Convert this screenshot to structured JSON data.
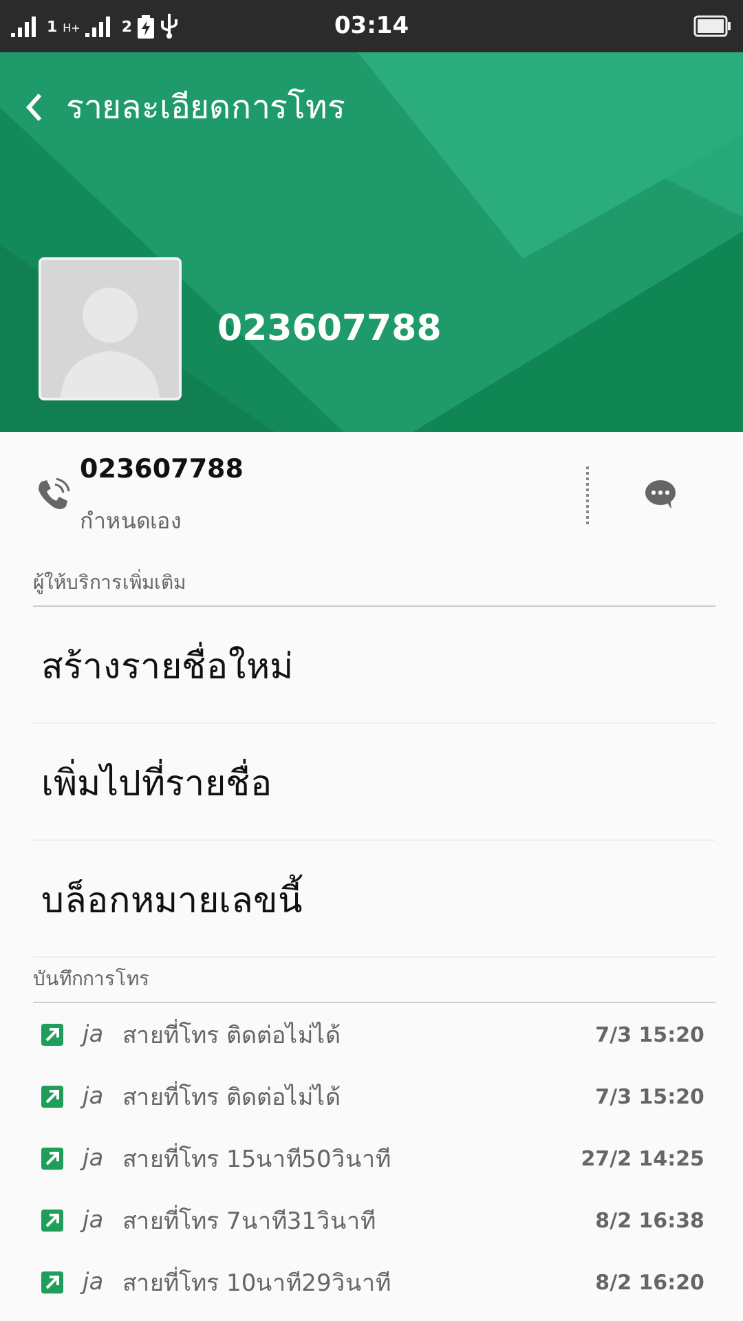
{
  "status_bar": {
    "sim1": "1",
    "network": "H+",
    "sim2": "2",
    "time": "03:14"
  },
  "header": {
    "title": "รายละเอียดการโทร",
    "name": "023607788"
  },
  "contact": {
    "number": "023607788",
    "label": "กำหนดเอง"
  },
  "providers_label": "ผู้ให้บริการเพิ่มเติม",
  "actions": [
    "สร้างรายชื่อใหม่",
    "เพิ่มไปที่รายชื่อ",
    "บล็อกหมายเลขนี้"
  ],
  "log_label": "บันทึกการโทร",
  "calls": [
    {
      "kind": "outgoing",
      "sim": "ja",
      "text": "สายที่โทร ติดต่อไม่ได้",
      "time": "7/3 15:20"
    },
    {
      "kind": "outgoing",
      "sim": "ja",
      "text": "สายที่โทร ติดต่อไม่ได้",
      "time": "7/3 15:20"
    },
    {
      "kind": "outgoing",
      "sim": "ja",
      "text": "สายที่โทร 15นาที50วินาที",
      "time": "27/2 14:25"
    },
    {
      "kind": "outgoing",
      "sim": "ja",
      "text": "สายที่โทร 7นาที31วินาที",
      "time": "8/2 16:38"
    },
    {
      "kind": "outgoing",
      "sim": "ja",
      "text": "สายที่โทร 10นาที29วินาที",
      "time": "8/2 16:20"
    }
  ]
}
